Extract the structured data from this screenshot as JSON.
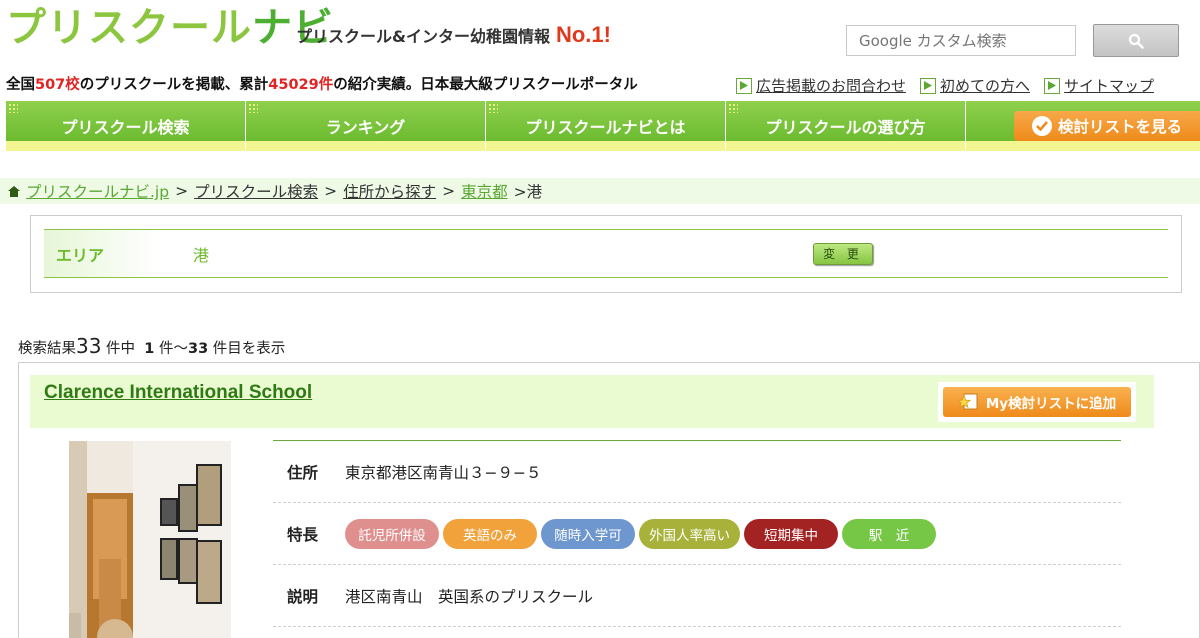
{
  "header": {
    "logo_part1": "プリスクール",
    "logo_part2": "ナビ",
    "tagline": "プリスクール&インター幼稚園情報",
    "tagline_badge": "No.1!",
    "search_placeholder": "Google カスタム検索",
    "search_icon": "magnifier-icon"
  },
  "subline": {
    "p1": "全国",
    "count_schools": "507校",
    "p2": "のプリスクールを掲載、累計",
    "count_referrals": "45029件",
    "p3": "の紹介実績。日本最大級プリスクールポータル"
  },
  "toplinks": [
    "広告掲載のお問合わせ",
    "初めての方へ",
    "サイトマップ"
  ],
  "nav": {
    "items": [
      "プリスクール検索",
      "ランキング",
      "プリスクールナビとは",
      "プリスクールの選び方"
    ],
    "list_button": "検討リストを見る"
  },
  "breadcrumb": {
    "links": [
      "プリスクールナビ.jp",
      "プリスクール検索",
      "住所から探す"
    ],
    "highlight": "東京都",
    "current": "港",
    "sep": ">"
  },
  "area": {
    "label": "エリア",
    "value": "港",
    "change_button": "変 更"
  },
  "results": {
    "prefix": "検索結果",
    "total": "33",
    "mid": " 件中  ",
    "from": "1",
    "range_mid": " 件〜",
    "to": "33",
    "suffix": " 件目を表示"
  },
  "card": {
    "title": "Clarence International School",
    "add_button": "My検討リストに追加",
    "address_label": "住所",
    "address": "東京都港区南青山３−９−５",
    "features_label": "特長",
    "tags": [
      {
        "label": "託児所併設",
        "color": "#e08f8f"
      },
      {
        "label": "英語のみ",
        "color": "#f1a23b"
      },
      {
        "label": "随時入学可",
        "color": "#6f97cf"
      },
      {
        "label": "外国人率高い",
        "color": "#a8b23a"
      },
      {
        "label": "短期集中",
        "color": "#a32323"
      },
      {
        "label": "駅　近",
        "color": "#77c746"
      }
    ],
    "desc_label": "説明",
    "desc": "港区南青山　英国系のプリスクール"
  },
  "colors": {
    "brand_green": "#6cbb30",
    "accent_orange": "#ef8a1a",
    "highlight_red": "#e02424"
  }
}
